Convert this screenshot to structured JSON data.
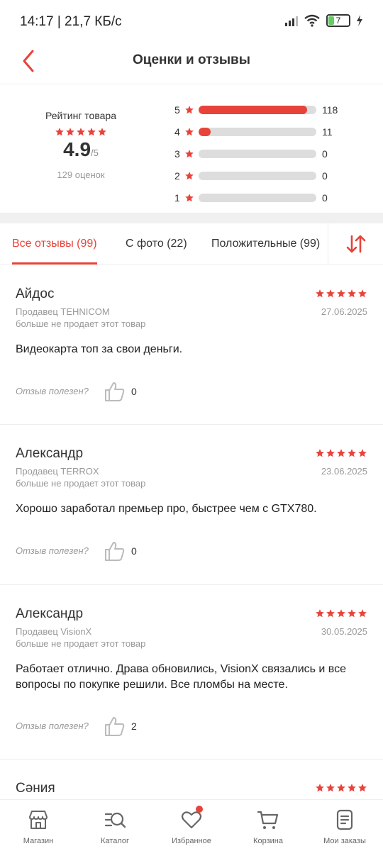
{
  "status_bar": {
    "time": "14:17 | 21,7 КБ/с",
    "battery": "7"
  },
  "header": {
    "title": "Оценки и отзывы"
  },
  "summary": {
    "label": "Рейтинг товара",
    "rating": "4.9",
    "rating_max": "/5",
    "count_text": "129 оценок",
    "distribution": [
      {
        "stars": "5",
        "count": "118",
        "fraction": 0.92
      },
      {
        "stars": "4",
        "count": "11",
        "fraction": 0.1
      },
      {
        "stars": "3",
        "count": "0",
        "fraction": 0
      },
      {
        "stars": "2",
        "count": "0",
        "fraction": 0
      },
      {
        "stars": "1",
        "count": "0",
        "fraction": 0
      }
    ]
  },
  "tabs": [
    {
      "label": "Все отзывы (99)",
      "active": true
    },
    {
      "label": "С фото (22)",
      "active": false
    },
    {
      "label": "Положительные (99)",
      "active": false
    }
  ],
  "helpful_label": "Отзыв полезен?",
  "reviews": [
    {
      "name": "Айдос",
      "seller": "Продавец TEHNICOM",
      "note": "больше не продает этот товар",
      "date": "27.06.2025",
      "text": "Видеокарта топ за свои деньги.",
      "helpful": "0"
    },
    {
      "name": "Александр",
      "seller": "Продавец TERROX",
      "note": "больше не продает этот товар",
      "date": "23.06.2025",
      "text": "Хорошо заработал премьер про, быстрее чем с GTX780.",
      "helpful": "0"
    },
    {
      "name": "Александр",
      "seller": "Продавец VisionX",
      "note": "больше не продает этот товар",
      "date": "30.05.2025",
      "text": "Работает отлично. Драва обновились, VisionX связались и все вопросы по покупке решили. Все пломбы на месте.",
      "helpful": "2"
    },
    {
      "name": "Сәния"
    }
  ],
  "bottom_nav": [
    {
      "label": "Магазин",
      "icon": "shop-icon"
    },
    {
      "label": "Каталог",
      "icon": "catalog-search-icon"
    },
    {
      "label": "Избранное",
      "icon": "heart-icon"
    },
    {
      "label": "Корзина",
      "icon": "cart-icon"
    },
    {
      "label": "Мои заказы",
      "icon": "orders-icon"
    }
  ],
  "colors": {
    "accent": "#e8433a",
    "muted": "#999999",
    "track": "#dddddd"
  }
}
